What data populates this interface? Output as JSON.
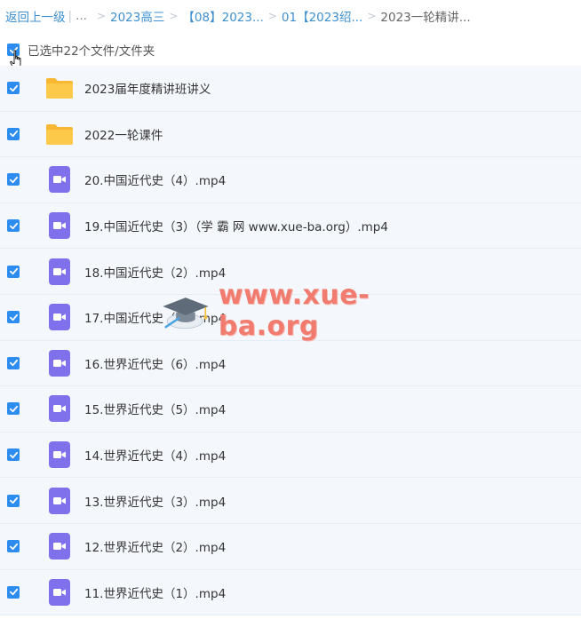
{
  "breadcrumb": {
    "back": "返回上一级",
    "ellipsis": "...",
    "items": [
      "2023高三",
      "【08】2023...",
      "01【2023绍...",
      "2023一轮精讲..."
    ]
  },
  "selection": {
    "text": "已选中22个文件/文件夹"
  },
  "colors": {
    "accent": "#2d8cf0",
    "link": "#3d8fd0",
    "folder": "#fcc94a",
    "video": "#7f71eb",
    "row_bg": "#f4f8fd"
  },
  "files": [
    {
      "name": "2023届年度精讲班讲义",
      "type": "folder"
    },
    {
      "name": "2022一轮课件",
      "type": "folder"
    },
    {
      "name": "20.中国近代史（4）.mp4",
      "type": "video"
    },
    {
      "name": "19.中国近代史（3）（学 霸 网 www.xue-ba.org）.mp4",
      "type": "video"
    },
    {
      "name": "18.中国近代史（2）.mp4",
      "type": "video"
    },
    {
      "name": "17.中国近代史（1）.mp4",
      "type": "video"
    },
    {
      "name": "16.世界近代史（6）.mp4",
      "type": "video"
    },
    {
      "name": "15.世界近代史（5）.mp4",
      "type": "video"
    },
    {
      "name": "14.世界近代史（4）.mp4",
      "type": "video"
    },
    {
      "name": "13.世界近代史（3）.mp4",
      "type": "video"
    },
    {
      "name": "12.世界近代史（2）.mp4",
      "type": "video"
    },
    {
      "name": "11.世界近代史（1）.mp4",
      "type": "video"
    }
  ],
  "watermark": {
    "text": "www.xue-ba.org"
  }
}
